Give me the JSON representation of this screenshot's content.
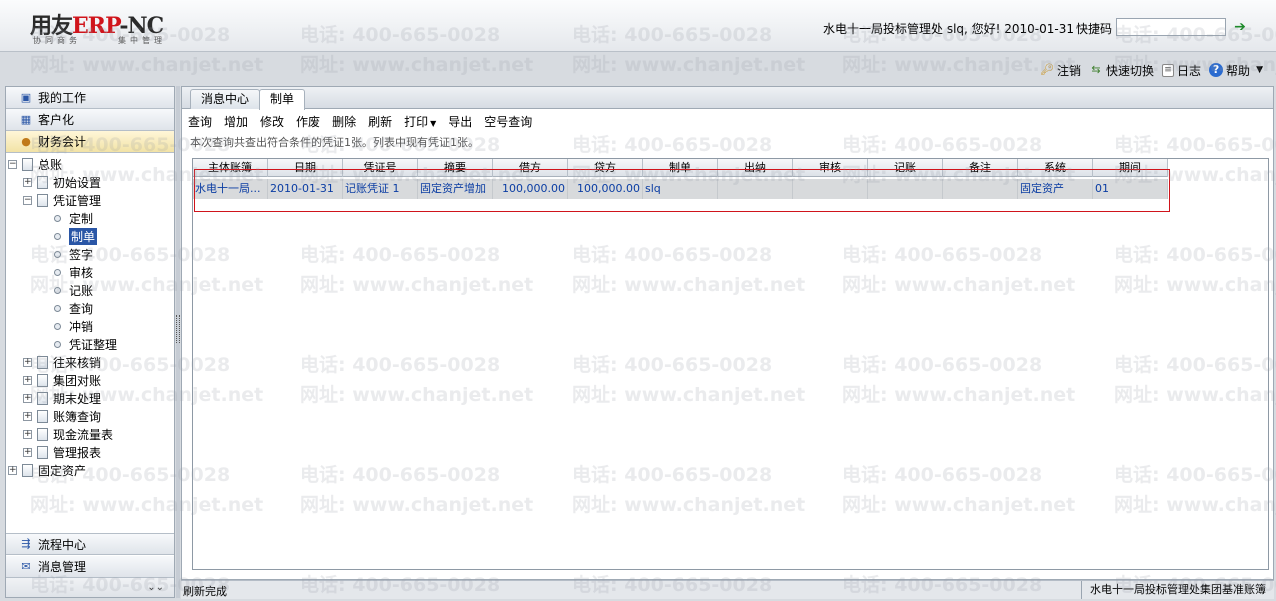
{
  "header": {
    "logo_main_a": "用友",
    "logo_main_b": "ERP",
    "logo_main_c": "-NC",
    "logo_sub1": "协同商务",
    "logo_sub2": "集中管理",
    "greeting": "水电十一局投标管理处 slq, 您好! 2010-01-31",
    "quick_code_label": "快捷码",
    "quick_code_value": "",
    "go_icon": "arrow-right-icon"
  },
  "toplinks": [
    {
      "label": "注销",
      "icon": "key-icon"
    },
    {
      "label": "快速切换",
      "icon": "switch-icon"
    },
    {
      "label": "日志",
      "icon": "log-icon"
    },
    {
      "label": "帮助",
      "icon": "help-icon"
    }
  ],
  "sidebar": {
    "accordion_top": [
      {
        "label": "我的工作",
        "icon": "monitor-icon"
      },
      {
        "label": "客户化",
        "icon": "grid-icon"
      },
      {
        "label": "财务会计",
        "icon": "user-icon"
      }
    ],
    "tree": {
      "root": "总账",
      "items": [
        {
          "label": "初始设置"
        },
        {
          "label": "凭证管理"
        },
        {
          "label": "定制"
        },
        {
          "label": "制单"
        },
        {
          "label": "签字"
        },
        {
          "label": "审核"
        },
        {
          "label": "记账"
        },
        {
          "label": "查询"
        },
        {
          "label": "冲销"
        },
        {
          "label": "凭证整理"
        },
        {
          "label": "往来核销"
        },
        {
          "label": "集团对账"
        },
        {
          "label": "期末处理"
        },
        {
          "label": "账簿查询"
        },
        {
          "label": "现金流量表"
        },
        {
          "label": "管理报表"
        }
      ],
      "root2": "固定资产"
    },
    "accordion_bottom": [
      {
        "label": "流程中心",
        "icon": "flow-icon"
      },
      {
        "label": "消息管理",
        "icon": "mail-icon"
      }
    ]
  },
  "main": {
    "tabs": [
      {
        "label": "消息中心"
      },
      {
        "label": "制单"
      }
    ],
    "toolbar": {
      "query": "查询",
      "add": "增加",
      "modify": "修改",
      "void": "作废",
      "delete": "删除",
      "refresh": "刷新",
      "print": "打印",
      "export": "导出",
      "empty_query": "空号查询"
    },
    "info": "本次查询共查出符合条件的凭证1张。列表中现有凭证1张。",
    "table": {
      "columns": [
        "主体账簿",
        "日期",
        "凭证号",
        "摘要",
        "借方",
        "贷方",
        "制单",
        "出纳",
        "审核",
        "记账",
        "备注",
        "系统",
        "期间"
      ],
      "rows": [
        [
          "水电十一局...",
          "2010-01-31",
          "记账凭证  1",
          "固定资产增加",
          "100,000.00",
          "100,000.00",
          "slq",
          "",
          "",
          "",
          "",
          "固定资产",
          "01"
        ]
      ]
    }
  },
  "status": {
    "left": "刷新完成",
    "right": "水电十一局投标管理处集团基准账簿"
  },
  "watermark": {
    "phone": "电话: 400-665-0028",
    "site": "网址: www.chanjet.net"
  }
}
